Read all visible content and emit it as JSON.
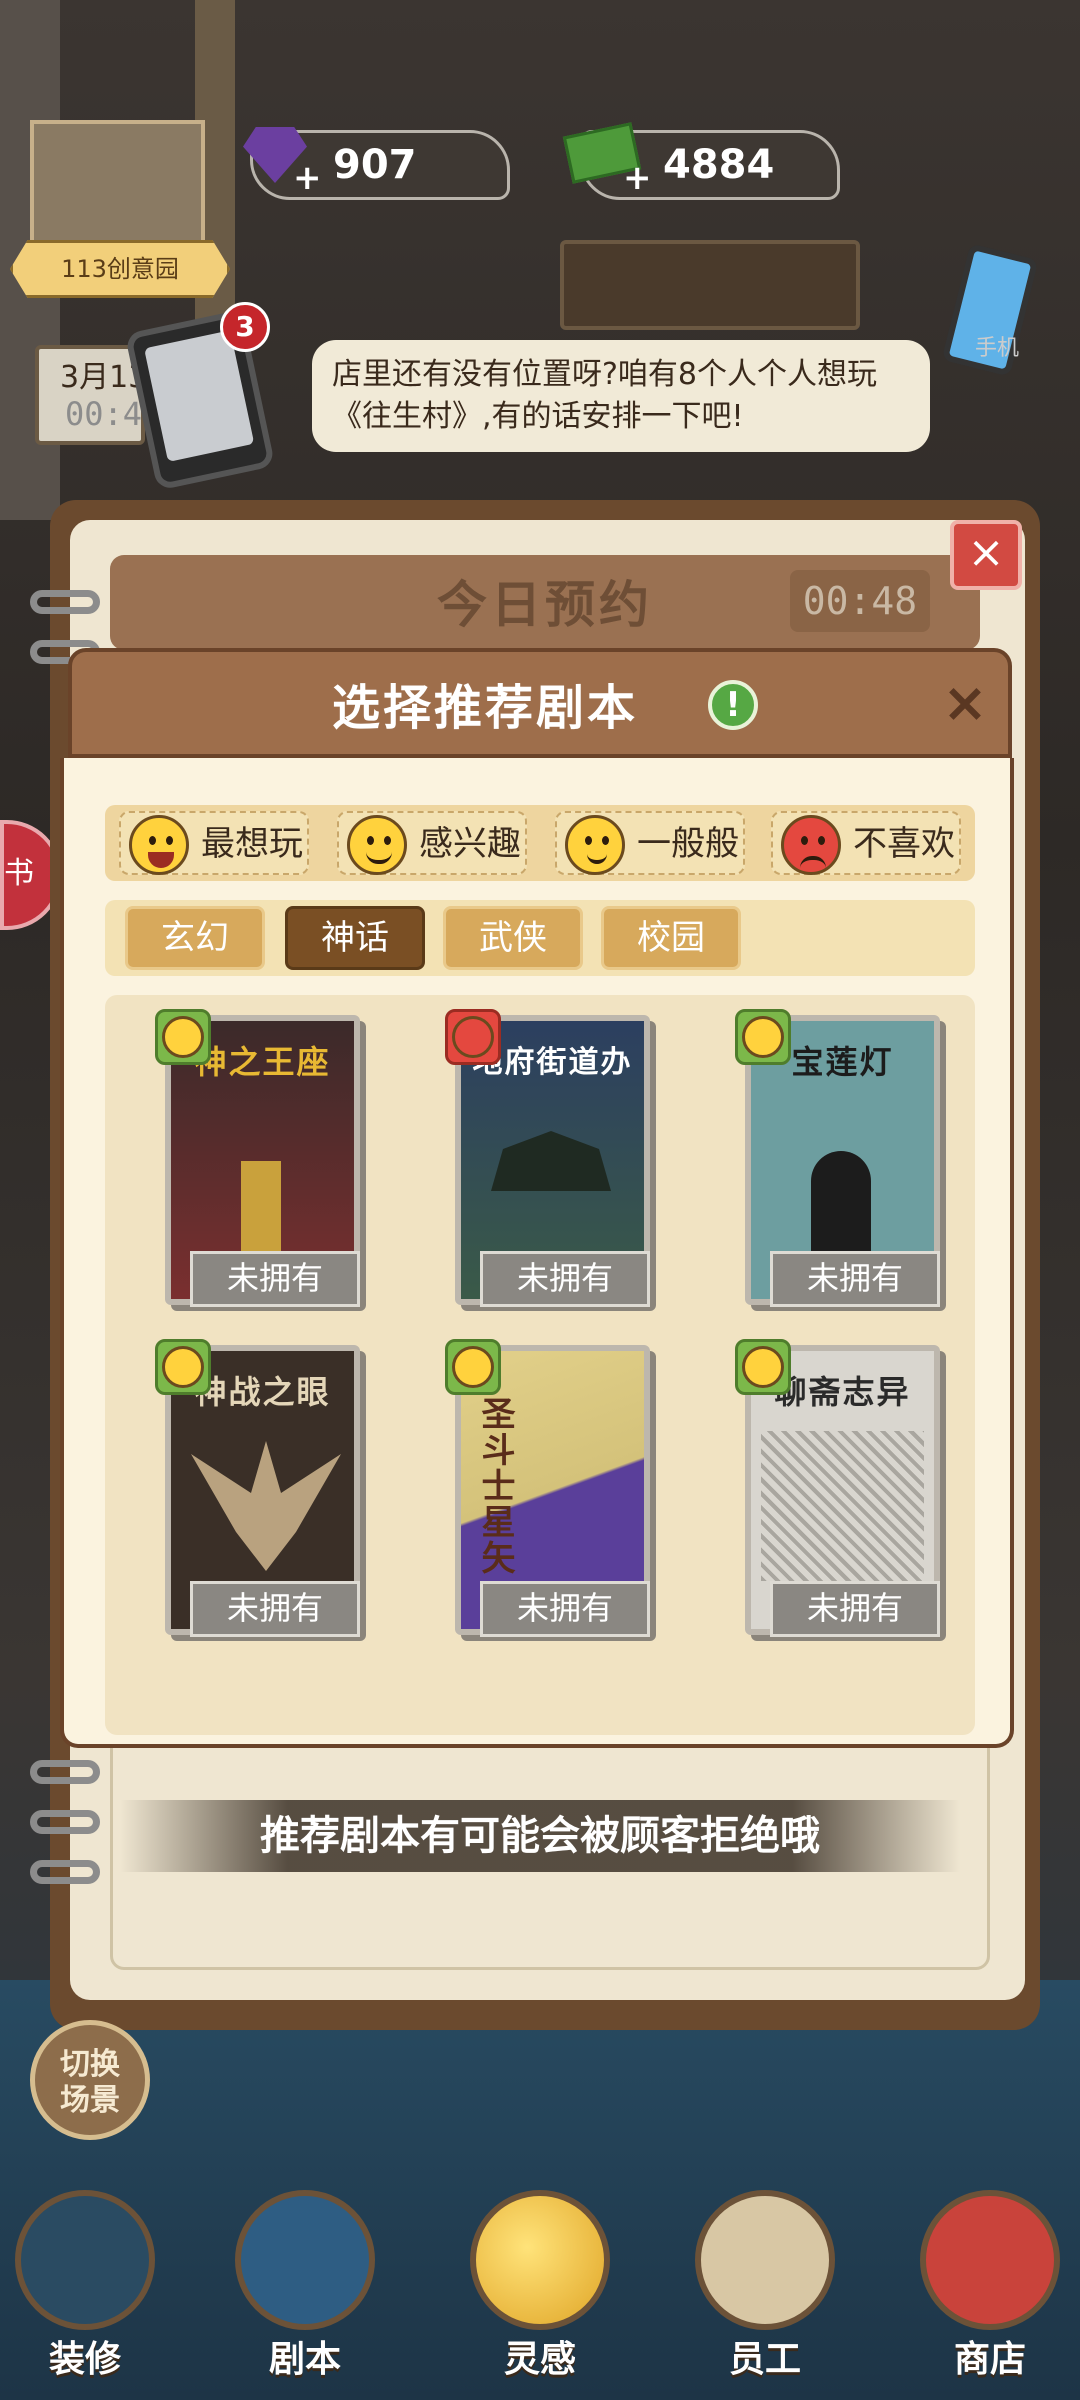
{
  "currency": {
    "gems": "907",
    "cash": "4884",
    "plus": "+"
  },
  "location": {
    "name": "113创意园",
    "date": "3月13",
    "time": "00:48"
  },
  "phone_badge": "3",
  "bubble_text": "店里还有没有位置呀?咱有8个人个人想玩《往生村》,有的话安排一下吧!",
  "right_phone_label": "手机",
  "side_tab": "书",
  "back_panel": {
    "title": "今日预约",
    "timer": "00:48",
    "close": "×"
  },
  "dialog": {
    "title": "选择推荐剧本",
    "info": "!",
    "close": "×"
  },
  "legend": [
    {
      "label": "最想玩",
      "mood": "happy"
    },
    {
      "label": "感兴趣",
      "mood": "smile"
    },
    {
      "label": "一般般",
      "mood": "neutral"
    },
    {
      "label": "不喜欢",
      "mood": "angry"
    }
  ],
  "categories": [
    "玄幻",
    "神话",
    "武侠",
    "校园"
  ],
  "active_category": "神话",
  "scripts": [
    {
      "title": "神之王座",
      "status": "未拥有",
      "mood": "neutral",
      "cover": "#6b2b2b"
    },
    {
      "title": "地府街道办",
      "status": "未拥有",
      "mood": "angry",
      "cover": "#2c3f60"
    },
    {
      "title": "宝莲灯",
      "status": "未拥有",
      "mood": "neutral",
      "cover": "#6d9ea0"
    },
    {
      "title": "神战之眼",
      "status": "未拥有",
      "mood": "neutral",
      "cover": "#3a2f27"
    },
    {
      "title": "圣斗士星矢",
      "status": "未拥有",
      "mood": "neutral",
      "cover": "#d4c27a"
    },
    {
      "title": "聊斋志异",
      "status": "未拥有",
      "mood": "neutral",
      "cover": "#d9d6cf"
    }
  ],
  "notice": "推荐剧本有可能会被顾客拒绝哦",
  "switch_scene": [
    "切换",
    "场景"
  ],
  "nav": [
    "装修",
    "剧本",
    "灵感",
    "员工",
    "商店"
  ],
  "colors": {
    "header": "#9e6e4b",
    "body": "#fbf3df",
    "active_tab": "#7a4f24",
    "tab": "#d7a95c",
    "accent_green": "#56a844"
  }
}
